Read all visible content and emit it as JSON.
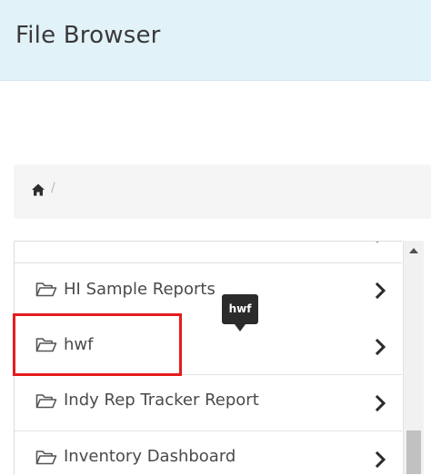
{
  "header": {
    "title": "File Browser"
  },
  "breadcrumb": {
    "home_icon": "home-icon",
    "separator": "/"
  },
  "list": {
    "items": [
      {
        "label": "",
        "icon": "folder-open-icon",
        "chevron": "chevron-right-icon"
      },
      {
        "label": "HI Sample Reports",
        "icon": "folder-open-icon",
        "chevron": "chevron-right-icon"
      },
      {
        "label": "hwf",
        "icon": "folder-open-icon",
        "chevron": "chevron-right-icon"
      },
      {
        "label": "Indy Rep Tracker Report",
        "icon": "folder-open-icon",
        "chevron": "chevron-right-icon"
      },
      {
        "label": "Inventory Dashboard",
        "icon": "folder-open-icon",
        "chevron": "chevron-right-icon"
      }
    ]
  },
  "tooltip": {
    "text": "hwf"
  },
  "highlight": {
    "color": "#e51c1c"
  },
  "colors": {
    "header_bg": "#e2f2f9",
    "tooltip_bg": "#2b2b2b"
  }
}
